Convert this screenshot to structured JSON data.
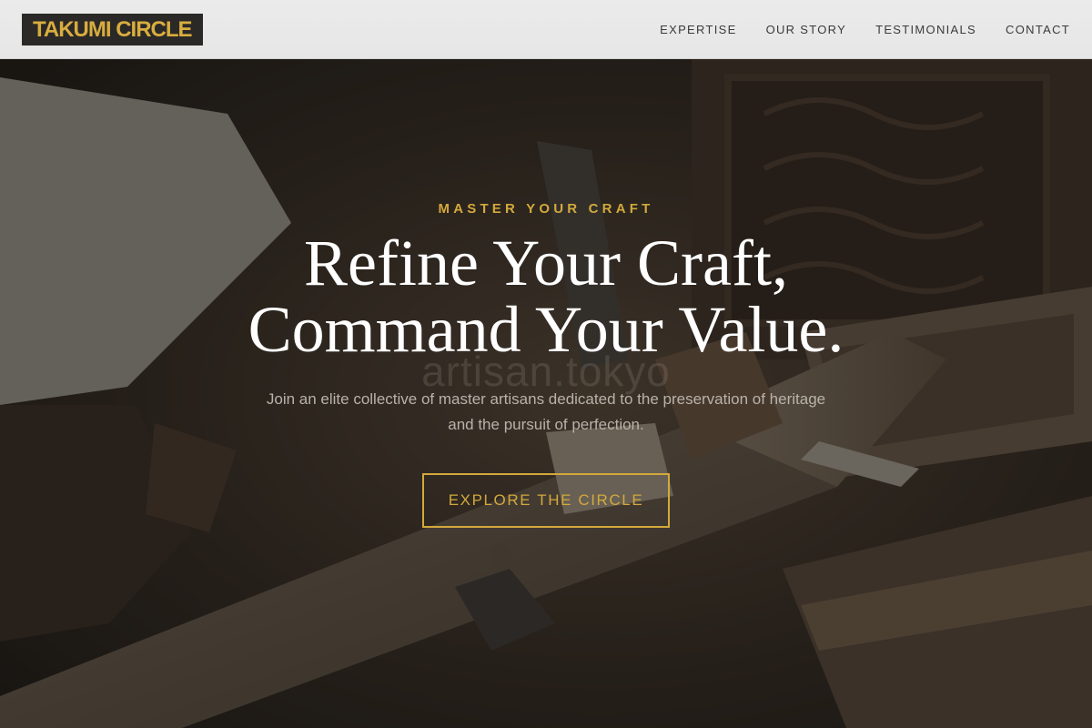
{
  "header": {
    "logo": "TAKUMI CIRCLE",
    "nav": [
      {
        "label": "EXPERTISE"
      },
      {
        "label": "OUR STORY"
      },
      {
        "label": "TESTIMONIALS"
      },
      {
        "label": "CONTACT"
      }
    ]
  },
  "hero": {
    "eyebrow": "MASTER YOUR CRAFT",
    "headline_line1": "Refine Your Craft,",
    "headline_line2": "Command Your Value.",
    "watermark": "artisan.tokyo",
    "subhead_line1": "Join an elite collective of master artisans dedicated to the preservation of heritage",
    "subhead_line2": "and the pursuit of perfection.",
    "cta_label": "EXPLORE THE CIRCLE"
  },
  "colors": {
    "accent_gold": "#d3a93c",
    "header_bg": "#e8e8e8",
    "logo_bg": "#2b2927",
    "overlay": "#161412"
  }
}
